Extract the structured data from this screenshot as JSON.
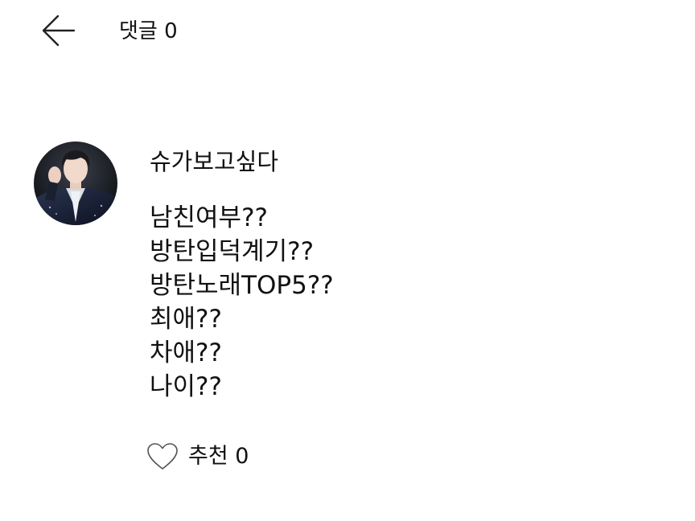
{
  "header": {
    "title": "댓글 0"
  },
  "comment": {
    "author": "슈가보고싶다",
    "lines": [
      "남친여부??",
      "방탄입덕계기??",
      "방탄노래TOP5??",
      "최애??",
      "차애??",
      "나이??"
    ],
    "like_label": "추천 0"
  },
  "icons": {
    "back": "arrow-left-icon",
    "like": "heart-outline-icon"
  }
}
